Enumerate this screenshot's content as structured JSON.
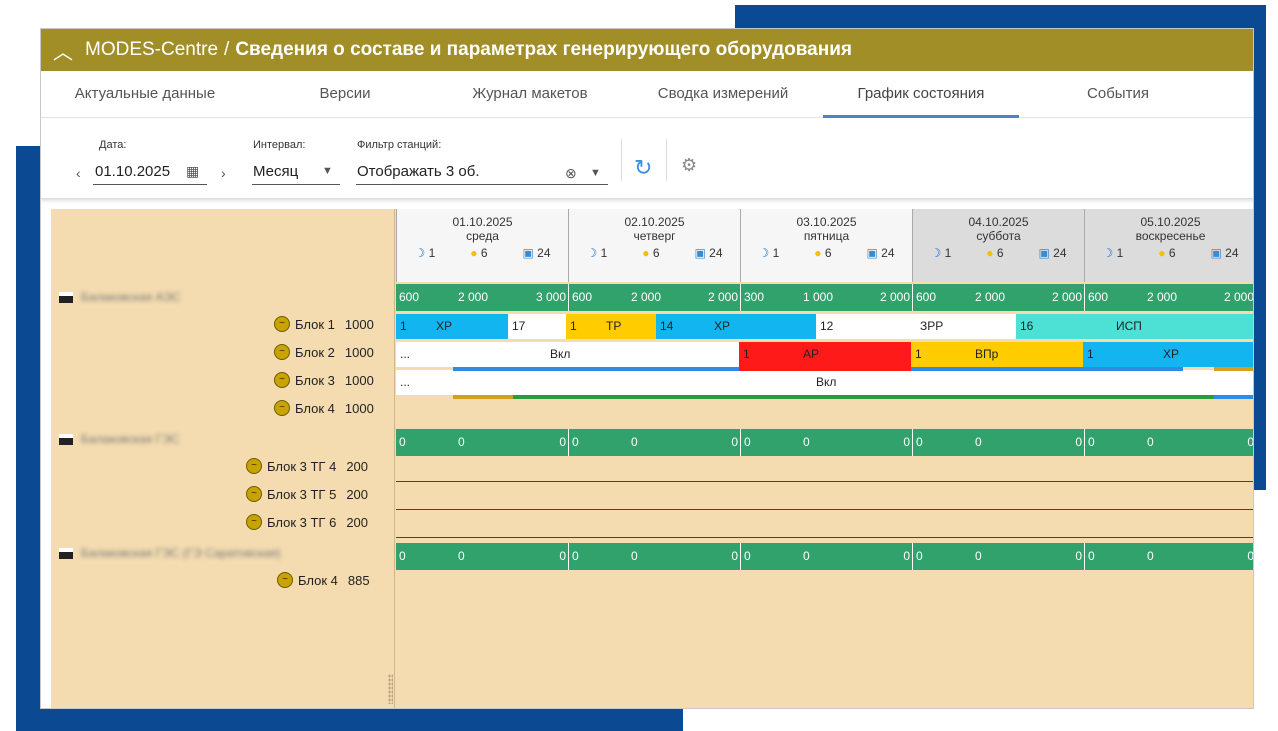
{
  "app": {
    "name": "MODES-Centre",
    "separator": "/",
    "title": "Сведения о составе и параметрах генерирующего оборудования"
  },
  "tabs": [
    {
      "label": "Актуальные данные"
    },
    {
      "label": "Версии"
    },
    {
      "label": "Журнал макетов"
    },
    {
      "label": "Сводка измерений"
    },
    {
      "label": "График состояния"
    },
    {
      "label": "События"
    }
  ],
  "toolbar": {
    "date_label": "Дата:",
    "date_value": "01.10.2025",
    "interval_label": "Интервал:",
    "interval_value": "Месяц",
    "filter_label": "Фильтр станций:",
    "filter_value": "Отображать 3 об."
  },
  "days": [
    {
      "date": "01.10.2025",
      "weekday": "среда",
      "n1": "1",
      "n2": "6",
      "n3": "24",
      "weekend": false
    },
    {
      "date": "02.10.2025",
      "weekday": "четверг",
      "n1": "1",
      "n2": "6",
      "n3": "24",
      "weekend": false
    },
    {
      "date": "03.10.2025",
      "weekday": "пятница",
      "n1": "1",
      "n2": "6",
      "n3": "24",
      "weekend": false
    },
    {
      "date": "04.10.2025",
      "weekday": "суббота",
      "n1": "1",
      "n2": "6",
      "n3": "24",
      "weekend": true
    },
    {
      "date": "05.10.2025",
      "weekday": "воскресенье",
      "n1": "1",
      "n2": "6",
      "n3": "24",
      "weekend": true
    }
  ],
  "stations": [
    {
      "name": "Балаковская АЭС",
      "summary": [
        [
          "600",
          "2 000",
          "3 000"
        ],
        [
          "600",
          "2 000",
          "2 000"
        ],
        [
          "300",
          "1 000",
          "2 000"
        ],
        [
          "600",
          "2 000",
          "2 000"
        ],
        [
          "600",
          "2 000",
          "2 000"
        ]
      ],
      "units": [
        {
          "name": "Блок 1",
          "value": "1000"
        },
        {
          "name": "Блок 2",
          "value": "1000"
        },
        {
          "name": "Блок 3",
          "value": "1000"
        },
        {
          "name": "Блок 4",
          "value": "1000"
        }
      ]
    },
    {
      "name": "Балаковская ГЭС",
      "summary": [
        [
          "0",
          "0",
          "0"
        ],
        [
          "0",
          "0",
          "0"
        ],
        [
          "0",
          "0",
          "0"
        ],
        [
          "0",
          "0",
          "0"
        ],
        [
          "0",
          "0",
          "0"
        ]
      ],
      "units": [
        {
          "name": "Блок 3 ТГ 4",
          "value": "200"
        },
        {
          "name": "Блок 3 ТГ 5",
          "value": "200"
        },
        {
          "name": "Блок 3 ТГ 6",
          "value": "200"
        }
      ]
    },
    {
      "name": "Балаковская ГЭС (ГЭ Саратовская)",
      "summary": [
        [
          "0",
          "0",
          "0"
        ],
        [
          "0",
          "0",
          "0"
        ],
        [
          "0",
          "0",
          "0"
        ],
        [
          "0",
          "0",
          "0"
        ],
        [
          "0",
          "0",
          "0"
        ]
      ],
      "units": [
        {
          "name": "Блок 4",
          "value": "885"
        }
      ]
    }
  ],
  "unit1_segments": [
    {
      "a": "1",
      "b": "ХР",
      "color": "#12b5f0"
    },
    {
      "a": "17",
      "b": "",
      "color": "#ffffff"
    },
    {
      "a": "1",
      "b": "ТР",
      "color": "#ffcc00"
    },
    {
      "a": "14",
      "b": "ХР",
      "color": "#12b5f0"
    },
    {
      "a": "12",
      "b": "ЗРР",
      "color": "#ffffff"
    },
    {
      "a": "16",
      "b": "ИСП",
      "color": "#4de0d4"
    }
  ],
  "unit2_segments": [
    {
      "a": "...",
      "b": "Вкл",
      "color": "#ffffff"
    },
    {
      "a": "1",
      "b": "АР",
      "color": "#ff1a1a"
    },
    {
      "a": "1",
      "b": "ВПр",
      "color": "#ffcc00"
    },
    {
      "a": "1",
      "b": "ХР",
      "color": "#12b5f0"
    }
  ],
  "unit3_segments": [
    {
      "a": "...",
      "b": "Вкл",
      "color": "#ffffff"
    }
  ],
  "colors": {
    "header": "#a18e27",
    "frame": "#0b4a93",
    "grid_bg": "#f4dcb0",
    "summary": "#31a26c"
  }
}
